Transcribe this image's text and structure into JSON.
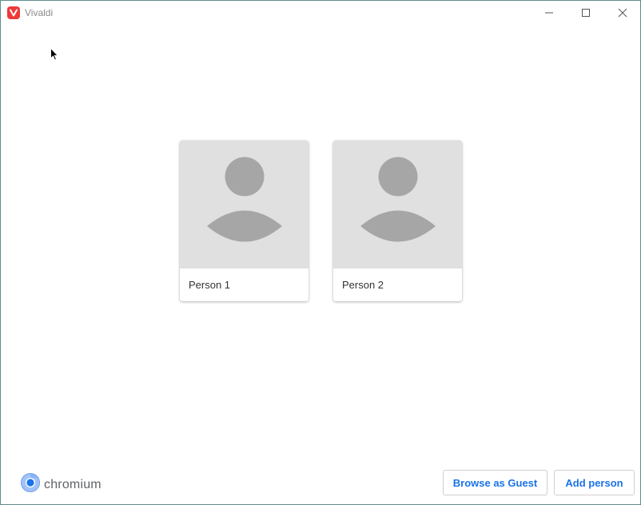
{
  "window": {
    "title": "Vivaldi",
    "app_icon": "vivaldi-icon",
    "accent_color": "#ef3939",
    "controls": [
      "minimize-icon",
      "maximize-icon",
      "close-icon"
    ]
  },
  "profiles": [
    {
      "name": "Person 1",
      "avatar": "default-avatar-icon"
    },
    {
      "name": "Person 2",
      "avatar": "default-avatar-icon"
    }
  ],
  "footer": {
    "brand": "chromium",
    "brand_icon": "chromium-icon",
    "guest_button": "Browse as Guest",
    "add_button": "Add person",
    "button_color": "#1a73e8"
  }
}
